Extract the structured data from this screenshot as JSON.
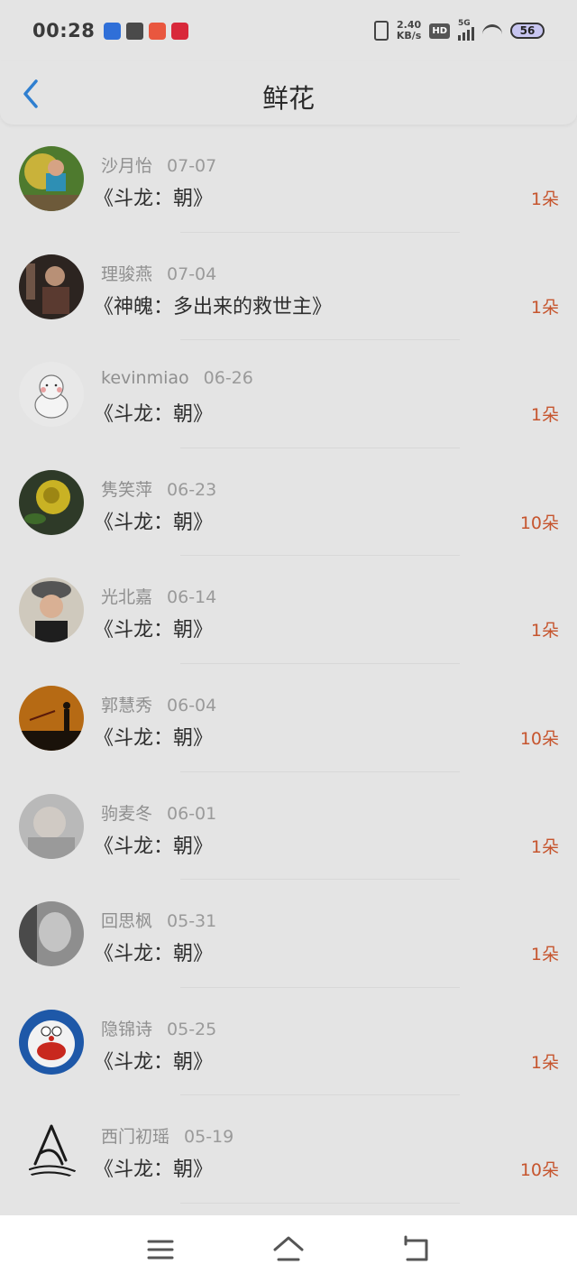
{
  "status_bar": {
    "time": "00:28",
    "speed_value": "2.40",
    "speed_unit": "KB/s",
    "hd_label": "HD",
    "network_label": "5G",
    "battery": "56"
  },
  "header": {
    "title": "鲜花"
  },
  "records": [
    {
      "name": "沙月怡",
      "date": "07-07",
      "book": "《斗龙：朝》",
      "count": "1朵"
    },
    {
      "name": "理骏燕",
      "date": "07-04",
      "book": "《神魄：多出来的救世主》",
      "count": "1朵"
    },
    {
      "name": "kevinmiao",
      "date": "06-26",
      "book": "《斗龙：朝》",
      "count": "1朵"
    },
    {
      "name": "隽笑萍",
      "date": "06-23",
      "book": "《斗龙：朝》",
      "count": "10朵"
    },
    {
      "name": "光北嘉",
      "date": "06-14",
      "book": "《斗龙：朝》",
      "count": "1朵"
    },
    {
      "name": "郭慧秀",
      "date": "06-04",
      "book": "《斗龙：朝》",
      "count": "10朵"
    },
    {
      "name": "驹麦冬",
      "date": "06-01",
      "book": "《斗龙：朝》",
      "count": "1朵"
    },
    {
      "name": "回思枫",
      "date": "05-31",
      "book": "《斗龙：朝》",
      "count": "1朵"
    },
    {
      "name": "隐锦诗",
      "date": "05-25",
      "book": "《斗龙：朝》",
      "count": "1朵"
    },
    {
      "name": "西门初瑶",
      "date": "05-19",
      "book": "《斗龙：朝》",
      "count": "10朵"
    }
  ],
  "colors": {
    "accent": "#2f7fd0",
    "count": "#c6552e"
  }
}
